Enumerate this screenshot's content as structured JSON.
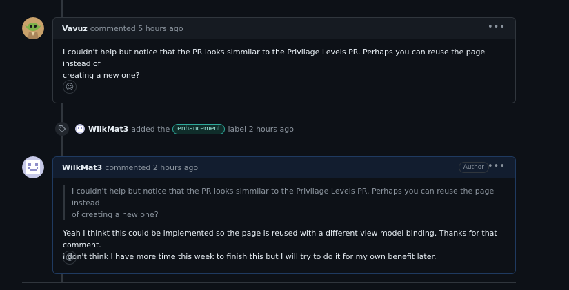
{
  "comments": [
    {
      "author": "Vavuz",
      "meta": "commented 5 hours ago",
      "paragraphs": [
        "I couldn't help but notice that the PR looks simmilar to the Privilage Levels PR. Perhaps you can reuse the page instead of",
        "creating a new one?"
      ]
    },
    {
      "author": "WilkMat3",
      "meta": "commented 2 hours ago",
      "badge": "Author",
      "quote": [
        "I couldn't help but notice that the PR looks simmilar to the Privilage Levels PR. Perhaps you can reuse the page instead",
        "of creating a new one?"
      ],
      "paragraphs": [
        "Yeah I thinkt this could be implemented so the page is reused with a different view model binding. Thanks for that comment.",
        "I don't think I have more time this week to finish this but I will try to do it for my own benefit later."
      ]
    }
  ],
  "event": {
    "actor": "WilkMat3",
    "action": "added the",
    "label": "enhancement",
    "suffix": "label 2 hours ago",
    "label_color": "#2ea89a"
  },
  "icons": {
    "more": "kebab-horizontal-icon",
    "reaction": "smiley-icon",
    "tag": "tag-icon"
  }
}
